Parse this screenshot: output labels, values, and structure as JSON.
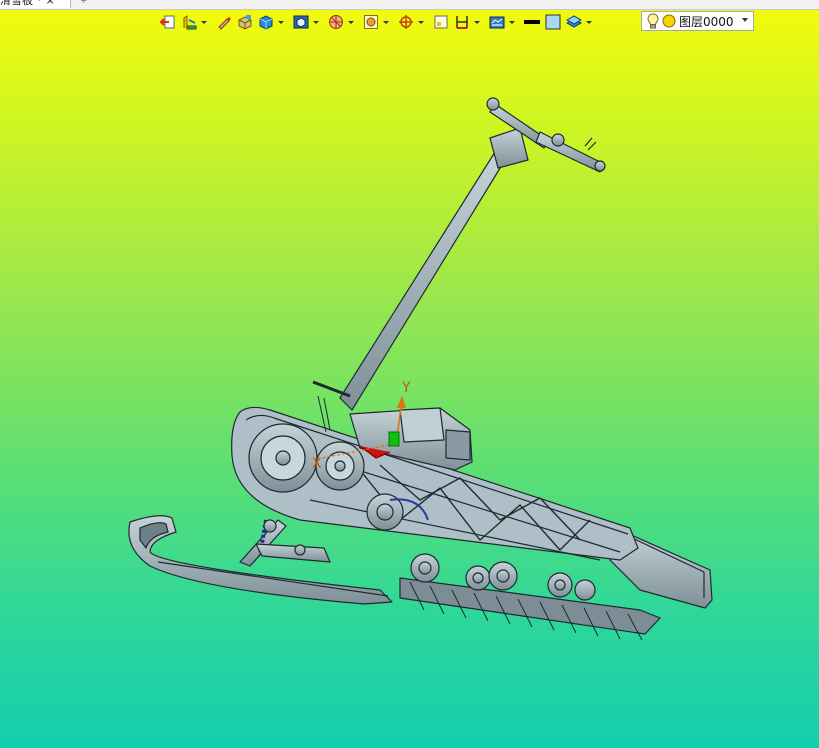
{
  "window": {
    "tab_title": "滑雪板 * ×"
  },
  "toolbar": {
    "buttons": [
      {
        "icon": "exit-sketch-icon",
        "dropdown": false
      },
      {
        "icon": "sketch-tools-icon",
        "dropdown": true
      },
      {
        "icon": "smart-brush-icon",
        "dropdown": false
      },
      {
        "icon": "smart-solid-icon",
        "dropdown": false
      },
      {
        "icon": "blue-cube-icon",
        "dropdown": true
      },
      {
        "icon": "render-mode-icon",
        "dropdown": true
      },
      {
        "icon": "section-view-icon",
        "dropdown": true
      },
      {
        "icon": "zoom-extents-icon",
        "dropdown": true
      },
      {
        "icon": "anchor-point-icon",
        "dropdown": true
      },
      {
        "icon": "frame-select-icon",
        "dropdown": false
      },
      {
        "icon": "dimension-icon",
        "dropdown": true
      },
      {
        "icon": "datum-plane-icon",
        "dropdown": true
      },
      {
        "icon": "line-color-icon",
        "dropdown": false
      },
      {
        "icon": "fill-color-icon",
        "dropdown": false
      },
      {
        "icon": "layer-stack-icon",
        "dropdown": true
      }
    ],
    "line_color": "#000000",
    "fill_color": "#a9d8f0"
  },
  "layer_select": {
    "value": "图层0000",
    "bulb_icon": "lightbulb-icon",
    "state_icon": "sun-icon"
  },
  "triad": {
    "y_label": "Y",
    "x_label": "X"
  },
  "canvas": {
    "gradient_top": "#f5fb0a",
    "gradient_bottom": "#14cfae",
    "model_fill": "#9fb2bb",
    "model_stroke": "#1e2a30"
  }
}
